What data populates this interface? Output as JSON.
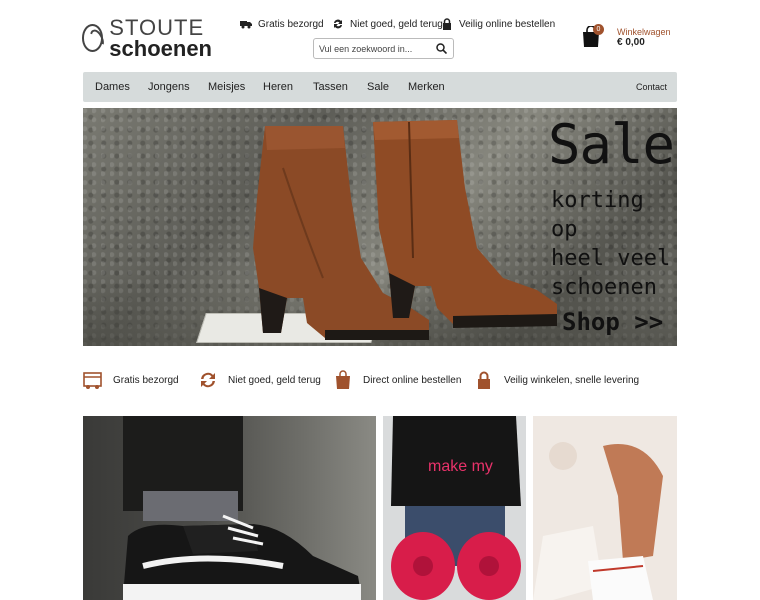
{
  "header": {
    "logo_top": "STOUTE",
    "logo_bottom": "schoenen",
    "usps": [
      "Gratis bezorgd",
      "Niet goed, geld terug",
      "Veilig online bestellen"
    ],
    "search_placeholder": "Vul een zoekwoord in...",
    "cart_label": "Winkelwagen",
    "cart_amount": "€ 0,00",
    "cart_count": "0"
  },
  "nav": {
    "items": [
      "Dames",
      "Jongens",
      "Meisjes",
      "Heren",
      "Tassen",
      "Sale",
      "Merken"
    ],
    "contact": "Contact"
  },
  "hero": {
    "title": "Sale",
    "subtitle_lines": [
      "korting op",
      "heel veel",
      "schoenen"
    ],
    "cta": "Shop >>"
  },
  "usps": [
    {
      "label": "Gratis bezorgd",
      "icon": "delivery-box-icon"
    },
    {
      "label": "Niet goed, geld terug",
      "icon": "refresh-arrows-icon"
    },
    {
      "label": "Direct online bestellen",
      "icon": "shopping-bag-icon"
    },
    {
      "label": "Veilig winkelen, snelle levering",
      "icon": "padlock-icon"
    }
  ],
  "tiles": [
    {
      "icon": "sneaker-photo"
    },
    {
      "icon": "kids-shirt-photo",
      "shirt_text": "make my"
    },
    {
      "icon": "kids-sneaker-photo"
    }
  ],
  "colors": {
    "accent": "#a0522d",
    "nav_bg": "#d6dbdb"
  }
}
